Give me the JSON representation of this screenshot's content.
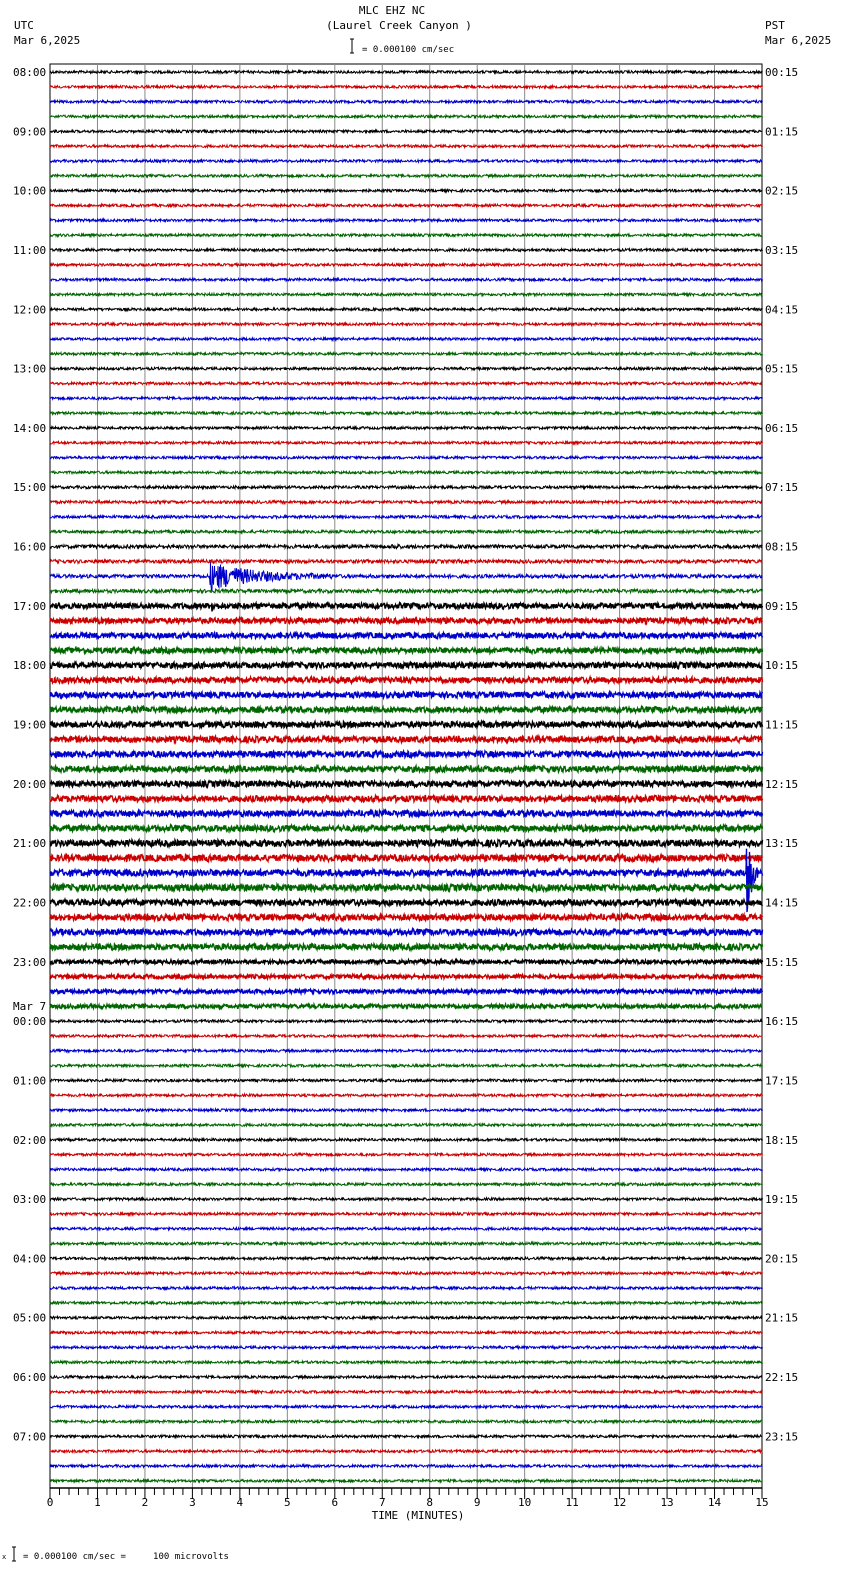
{
  "header": {
    "station": "MLC EHZ NC",
    "location": "(Laurel Creek Canyon )",
    "left_tz": "UTC",
    "left_date": "Mar 6,2025",
    "right_tz": "PST",
    "right_date": "Mar 6,2025",
    "scale_text": "= 0.000100 cm/sec"
  },
  "footer": {
    "scale_text": "= 0.000100 cm/sec =     100 microvolts",
    "prefix": "x"
  },
  "chart_data": {
    "type": "line",
    "title": "MLC EHZ NC (Laurel Creek Canyon )",
    "xlabel": "TIME (MINUTES)",
    "xlim": [
      0,
      15
    ],
    "xticks": [
      "0",
      "1",
      "2",
      "3",
      "4",
      "5",
      "6",
      "7",
      "8",
      "9",
      "10",
      "11",
      "12",
      "13",
      "14",
      "15"
    ],
    "traces_per_hour": 4,
    "trace_colors": [
      "#000000",
      "#cc0000",
      "#0000cc",
      "#006600"
    ],
    "left_labels": [
      "08:00",
      "09:00",
      "10:00",
      "11:00",
      "12:00",
      "13:00",
      "14:00",
      "15:00",
      "16:00",
      "17:00",
      "18:00",
      "19:00",
      "20:00",
      "21:00",
      "22:00",
      "23:00",
      "00:00",
      "01:00",
      "02:00",
      "03:00",
      "04:00",
      "05:00",
      "06:00",
      "07:00"
    ],
    "date_change_label": "Mar 7",
    "right_labels": [
      "00:15",
      "01:15",
      "02:15",
      "03:15",
      "04:15",
      "05:15",
      "06:15",
      "07:15",
      "08:15",
      "09:15",
      "10:15",
      "11:15",
      "12:15",
      "13:15",
      "14:15",
      "15:15",
      "16:15",
      "17:15",
      "18:15",
      "19:15",
      "20:15",
      "21:15",
      "22:15",
      "23:15"
    ],
    "relative_noise_by_hour": [
      1,
      1,
      1,
      1,
      1,
      1,
      1,
      1.1,
      1.4,
      2.2,
      2.3,
      2.4,
      2.4,
      2.6,
      2.4,
      1.6,
      1,
      1,
      1,
      1,
      1,
      1,
      1,
      1
    ],
    "events": [
      {
        "trace": 34,
        "start_min": 3.35,
        "duration_min": 2.6,
        "amplitude": 14
      },
      {
        "trace": 36,
        "start_min": 3.4,
        "duration_min": 0.15,
        "amplitude": 6
      },
      {
        "trace": 54,
        "start_min": 14.65,
        "duration_min": 0.3,
        "amplitude": 55
      },
      {
        "trace": 32,
        "start_min": 7.2,
        "duration_min": 0.2,
        "amplitude": 4
      }
    ]
  }
}
